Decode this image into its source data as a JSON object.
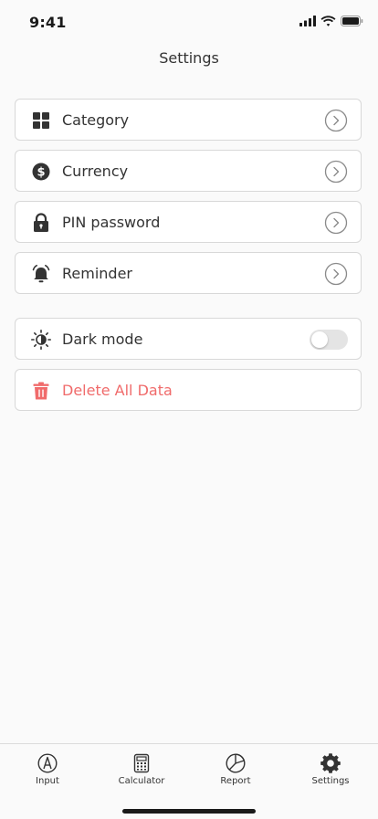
{
  "status_bar": {
    "time": "9:41"
  },
  "header": {
    "title": "Settings"
  },
  "menu": [
    {
      "label": "Category",
      "icon": "grid-icon"
    },
    {
      "label": "Currency",
      "icon": "dollar-circle-icon"
    },
    {
      "label": "PIN password",
      "icon": "lock-icon"
    },
    {
      "label": "Reminder",
      "icon": "bell-icon"
    }
  ],
  "dark_mode": {
    "label": "Dark mode",
    "icon": "brightness-icon",
    "enabled": false
  },
  "delete_all": {
    "label": "Delete All Data",
    "icon": "trash-icon",
    "color": "#f06b6b"
  },
  "tabbar": {
    "tabs": [
      {
        "label": "Input",
        "icon": "pencil-circle-icon"
      },
      {
        "label": "Calculator",
        "icon": "calculator-icon"
      },
      {
        "label": "Report",
        "icon": "pie-chart-icon"
      },
      {
        "label": "Settings",
        "icon": "gear-icon",
        "active": true
      }
    ]
  },
  "colors": {
    "background": "#fafafa",
    "card_border": "#d8d8d8",
    "text": "#333333",
    "danger": "#f06b6b",
    "toggle_off": "#e4e4e4"
  }
}
